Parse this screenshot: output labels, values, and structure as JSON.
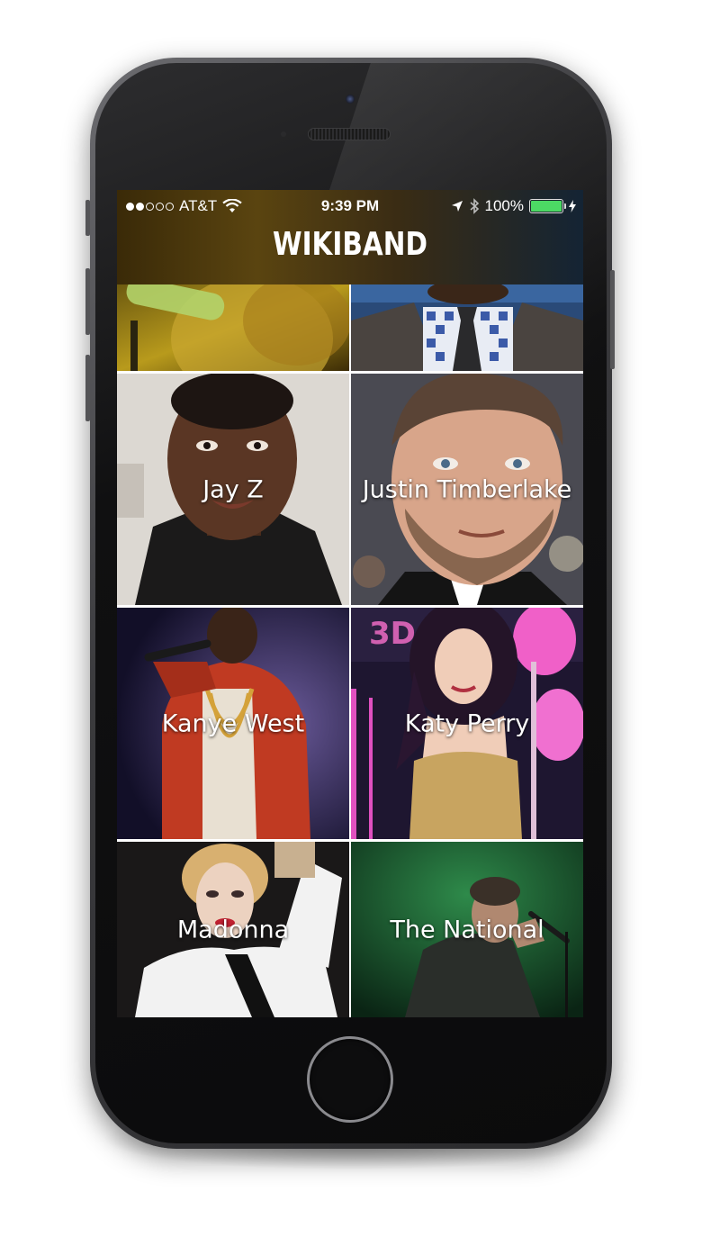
{
  "status_bar": {
    "carrier": "AT&T",
    "time": "9:39 PM",
    "battery_percent": "100%",
    "signal_bars": 2,
    "battery_level": 1.0,
    "battery_color": "#4cd964"
  },
  "app": {
    "title": "WIKIBAND"
  },
  "artists": [
    {
      "name": "",
      "icon": "partial-artist-photo-singer"
    },
    {
      "name": "",
      "icon": "partial-artist-photo-suit"
    },
    {
      "name": "Jay Z",
      "icon": "artist-photo"
    },
    {
      "name": "Justin Timberlake",
      "icon": "artist-photo"
    },
    {
      "name": "Kanye West",
      "icon": "artist-photo"
    },
    {
      "name": "Katy Perry",
      "icon": "artist-photo"
    },
    {
      "name": "Madonna",
      "icon": "artist-photo"
    },
    {
      "name": "The National",
      "icon": "artist-photo"
    }
  ]
}
